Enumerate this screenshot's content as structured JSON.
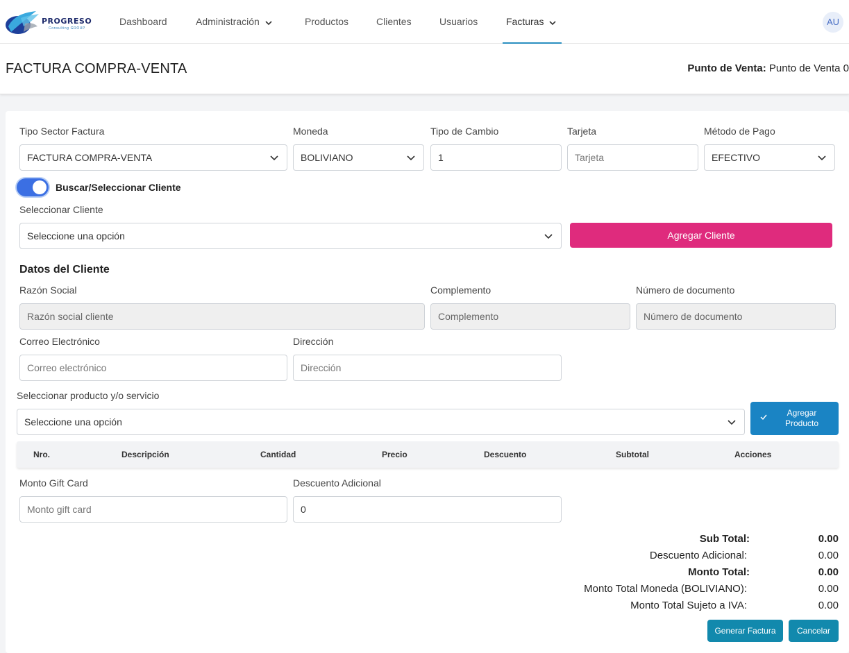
{
  "nav": {
    "logo_text": "PROGRESO",
    "logo_sub": "Consulting GROUP",
    "items": [
      {
        "label": "Dashboard"
      },
      {
        "label": "Administración"
      },
      {
        "label": "Productos"
      },
      {
        "label": "Clientes"
      },
      {
        "label": "Usuarios"
      },
      {
        "label": "Facturas"
      }
    ],
    "avatar": "AU",
    "accent": "#2a8fc0"
  },
  "header": {
    "title": "FACTURA COMPRA-VENTA",
    "pv_label": "Punto de Venta:",
    "pv_value": "Punto de Venta 0"
  },
  "form": {
    "tipo_sector": {
      "label": "Tipo Sector Factura",
      "value": "FACTURA COMPRA-VENTA"
    },
    "moneda": {
      "label": "Moneda",
      "value": "BOLIVIANO"
    },
    "tipo_cambio": {
      "label": "Tipo de Cambio",
      "value": "1"
    },
    "tarjeta": {
      "label": "Tarjeta",
      "placeholder": "Tarjeta"
    },
    "metodo_pago": {
      "label": "Método de Pago",
      "value": "EFECTIVO"
    },
    "toggle_label": "Buscar/Seleccionar Cliente",
    "cliente": {
      "label": "Seleccionar Cliente",
      "value": "Seleccione una opción"
    },
    "agregar_cliente": "Agregar Cliente",
    "datos_title": "Datos del Cliente",
    "razon_social": {
      "label": "Razón Social",
      "placeholder": "Razón social cliente"
    },
    "complemento": {
      "label": "Complemento",
      "placeholder": "Complemento"
    },
    "num_doc": {
      "label": "Número de documento",
      "placeholder": "Número de documento"
    },
    "correo": {
      "label": "Correo Electrónico",
      "placeholder": "Correo electrónico"
    },
    "direccion": {
      "label": "Dirección",
      "placeholder": "Dirección"
    },
    "producto": {
      "label": "Seleccionar producto y/o servicio",
      "value": "Seleccione una opción"
    },
    "agregar_producto_1": "Agregar",
    "agregar_producto_2": "Producto",
    "gift": {
      "label": "Monto Gift Card",
      "placeholder": "Monto gift card"
    },
    "desc_adicional": {
      "label": "Descuento Adicional",
      "value": "0"
    }
  },
  "table": {
    "headers": [
      "Nro.",
      "Descripción",
      "Cantidad",
      "Precio",
      "Descuento",
      "Subtotal",
      "Acciones"
    ]
  },
  "totals": [
    {
      "label": "Sub Total:",
      "value": "0.00"
    },
    {
      "label": "Descuento Adicional:",
      "value": "0.00"
    },
    {
      "label": "Monto Total:",
      "value": "0.00"
    },
    {
      "label": "Monto Total Moneda (BOLIVIANO):",
      "value": "0.00"
    },
    {
      "label": "Monto Total Sujeto a IVA:",
      "value": "0.00"
    }
  ],
  "actions": {
    "generar": "Generar Factura",
    "cancelar": "Cancelar"
  },
  "colors": {
    "pink": "#df2b7d",
    "blue": "#1a84c4",
    "teal": "#1289ad",
    "toggle": "#3b6fe3"
  }
}
